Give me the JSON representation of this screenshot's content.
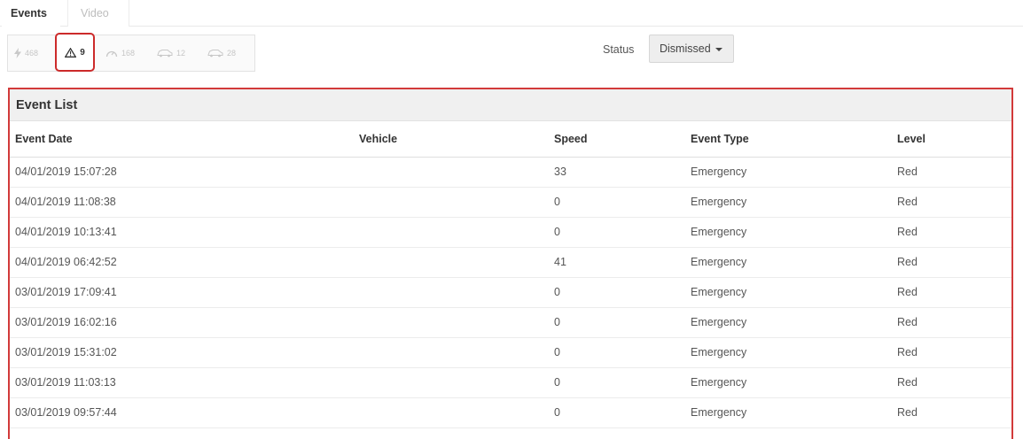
{
  "tabs": [
    {
      "label": "Events",
      "active": true
    },
    {
      "label": "Video",
      "active": false
    }
  ],
  "filters": [
    {
      "icon": "speed-bolt-icon",
      "count": "468"
    },
    {
      "icon": "warning-triangle-icon",
      "count": "9",
      "active": true
    },
    {
      "icon": "speedometer-icon",
      "count": "168"
    },
    {
      "icon": "car-brake-icon",
      "count": "12"
    },
    {
      "icon": "car-accelerate-icon",
      "count": "28"
    }
  ],
  "status": {
    "label": "Status",
    "value": "Dismissed"
  },
  "event_list": {
    "title": "Event List",
    "columns": [
      "Event Date",
      "Vehicle",
      "Speed",
      "Event Type",
      "Level"
    ],
    "rows": [
      {
        "date": "04/01/2019 15:07:28",
        "vehicle": "",
        "speed": "33",
        "type": "Emergency",
        "level": "Red"
      },
      {
        "date": "04/01/2019 11:08:38",
        "vehicle": "",
        "speed": "0",
        "type": "Emergency",
        "level": "Red"
      },
      {
        "date": "04/01/2019 10:13:41",
        "vehicle": "",
        "speed": "0",
        "type": "Emergency",
        "level": "Red"
      },
      {
        "date": "04/01/2019 06:42:52",
        "vehicle": "",
        "speed": "41",
        "type": "Emergency",
        "level": "Red"
      },
      {
        "date": "03/01/2019 17:09:41",
        "vehicle": "",
        "speed": "0",
        "type": "Emergency",
        "level": "Red"
      },
      {
        "date": "03/01/2019 16:02:16",
        "vehicle": "",
        "speed": "0",
        "type": "Emergency",
        "level": "Red"
      },
      {
        "date": "03/01/2019 15:31:02",
        "vehicle": "",
        "speed": "0",
        "type": "Emergency",
        "level": "Red"
      },
      {
        "date": "03/01/2019 11:03:13",
        "vehicle": "",
        "speed": "0",
        "type": "Emergency",
        "level": "Red"
      },
      {
        "date": "03/01/2019 09:57:44",
        "vehicle": "",
        "speed": "0",
        "type": "Emergency",
        "level": "Red"
      }
    ]
  },
  "colors": {
    "highlight": "#cc2a2a",
    "header_bg": "#f0f0f0"
  }
}
